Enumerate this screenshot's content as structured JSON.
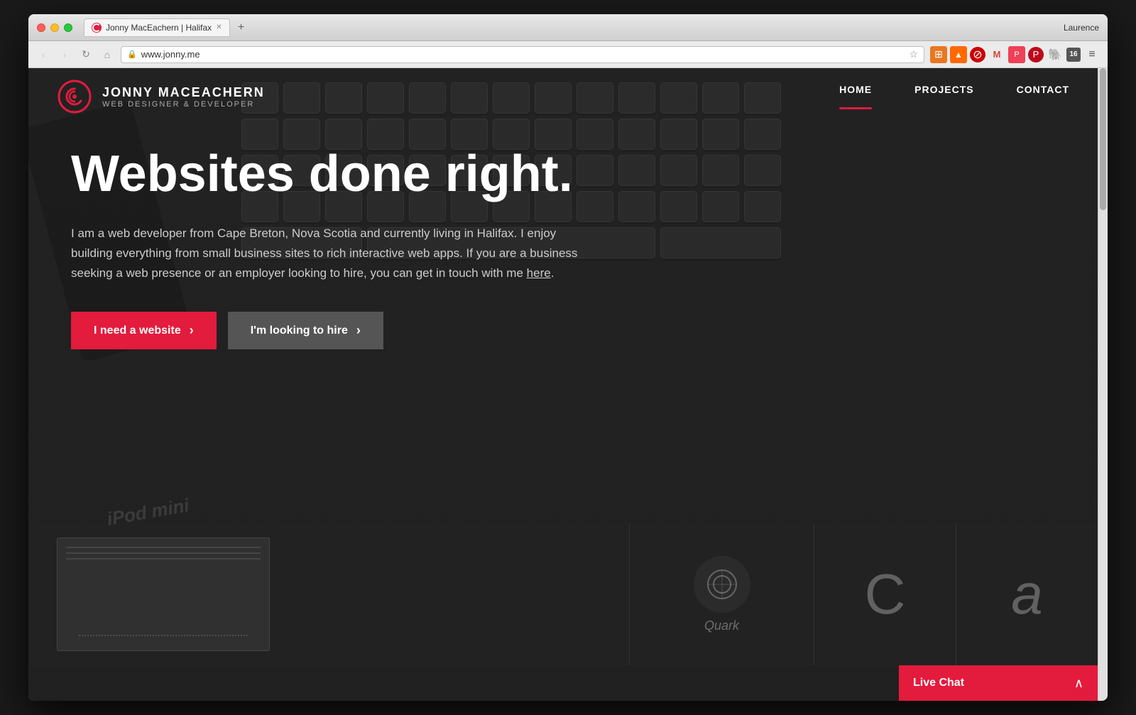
{
  "window": {
    "title": "Jonny MacEachern | Halifax",
    "url": "www.jonny.me",
    "user": "Laurence"
  },
  "nav": {
    "back_disabled": true,
    "forward_disabled": true,
    "home_icon": "🏠",
    "star_icon": "☆"
  },
  "toolbar": {
    "icons": [
      {
        "name": "layers-icon",
        "symbol": "⊞",
        "label": "Layers"
      },
      {
        "name": "chart-icon",
        "symbol": "📈",
        "label": "Chart"
      },
      {
        "name": "block-icon",
        "symbol": "⊘",
        "label": "Block"
      },
      {
        "name": "gmail-icon",
        "symbol": "M",
        "label": "Gmail"
      },
      {
        "name": "pocket-icon",
        "symbol": "P",
        "label": "Pocket"
      },
      {
        "name": "pinterest-icon",
        "symbol": "P",
        "label": "Pinterest"
      },
      {
        "name": "evernote-icon",
        "symbol": "🐘",
        "label": "Evernote"
      },
      {
        "name": "num-icon",
        "symbol": "16",
        "label": "16"
      },
      {
        "name": "menu-icon",
        "symbol": "≡",
        "label": "Menu"
      }
    ]
  },
  "site": {
    "logo": {
      "name": "JONNY MACEACHERN",
      "subtitle": "WEB DESIGNER & DEVELOPER"
    },
    "nav_links": [
      {
        "label": "HOME",
        "active": true
      },
      {
        "label": "PROJECTS",
        "active": false
      },
      {
        "label": "CONTACT",
        "active": false
      }
    ],
    "hero": {
      "headline": "Websites done right.",
      "body": "I am a web developer from Cape Breton, Nova Scotia and currently living in Halifax. I enjoy building everything from small business sites to rich interactive web apps. If you are a business seeking a web presence or an employer looking to hire, you can get in touch with me here.",
      "link_text": "here",
      "btn_primary": "I need a website",
      "btn_secondary": "I'm looking to hire"
    },
    "live_chat": {
      "label": "Live Chat",
      "chevron": "∧"
    },
    "projects": [
      {
        "name": "quark",
        "label": "Quark"
      },
      {
        "name": "proj2",
        "label": "C"
      },
      {
        "name": "proj3",
        "label": "a"
      }
    ]
  }
}
